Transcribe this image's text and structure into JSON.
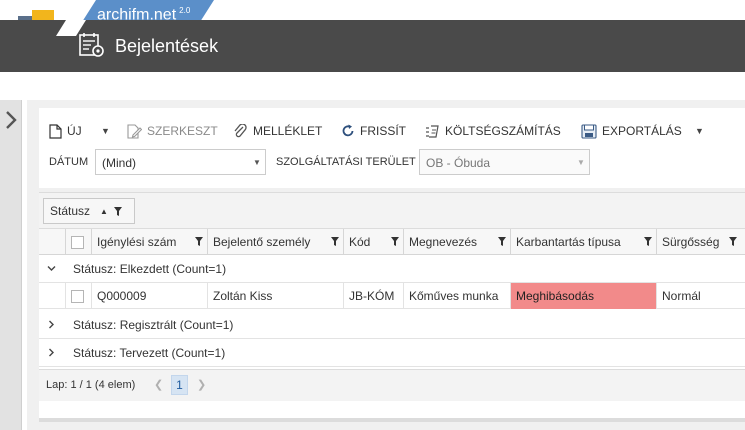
{
  "brand": {
    "name": "archifm.net",
    "version": "2.0"
  },
  "page": {
    "title": "Bejelentések"
  },
  "toolbar": {
    "new_label": "ÚJ",
    "edit_label": "SZERKESZT",
    "attachment_label": "MELLÉKLET",
    "refresh_label": "FRISSÍT",
    "costing_label": "KÖLTSÉGSZÁMÍTÁS",
    "export_label": "EXPORTÁLÁS"
  },
  "filters": {
    "date_label": "DÁTUM",
    "date_value": "(Mind)",
    "area_label": "SZOLGÁLTATÁSI TERÜLET",
    "area_value": "OB - Óbuda"
  },
  "grid": {
    "group_by_label": "Státusz",
    "columns": [
      "Igénylési szám",
      "Bejelentő személy",
      "Kód",
      "Megnevezés",
      "Karbantartás típusa",
      "Sürgősség"
    ],
    "groups": [
      {
        "label": "Státusz: Elkezdett (Count=1)",
        "expanded": true
      },
      {
        "label": "Státusz: Regisztrált (Count=1)",
        "expanded": false
      },
      {
        "label": "Státusz: Tervezett (Count=1)",
        "expanded": false
      }
    ],
    "rows": [
      {
        "id": "Q000009",
        "reporter": "Zoltán Kiss",
        "code": "JB-KÓM",
        "name": "Kőműves munka",
        "maintenance_type": "Meghibásodás",
        "urgency": "Normál"
      }
    ],
    "highlight_color": "#f28a8a"
  },
  "pager": {
    "info": "Lap: 1 / 1 (4 elem)",
    "current_page": "1"
  },
  "colors": {
    "title_bar": "#4a4a4a",
    "brand_tab": "#5b8fc9",
    "logo_blue": "#3d7fc5",
    "logo_gray": "#5a6f8a",
    "logo_yellow": "#f2b51c"
  },
  "icons": [
    "new-document-icon",
    "edit-icon",
    "paperclip-icon",
    "refresh-icon",
    "calculator-icon",
    "export-icon",
    "filter-icon",
    "sort-icon",
    "expand-icon",
    "collapse-icon",
    "report-settings-icon",
    "sidebar-toggle-icon"
  ]
}
